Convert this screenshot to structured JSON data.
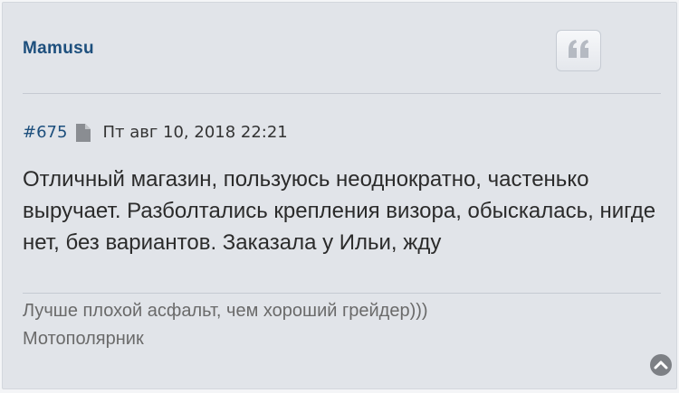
{
  "post": {
    "author": "Mamusu",
    "number": "#675",
    "date": "Пт авг 10, 2018 22:21",
    "text": "Отличный магазин, пользуюсь неоднократно, частенько выручает. Разболтались крепления визора, обыскалась, нигде нет, без вариантов. Заказала у Ильи, жду"
  },
  "signature": {
    "line1": "Лучше плохой асфальт, чем хороший грейдер)))",
    "line2": "Мотополярник"
  },
  "icons": {
    "quote": "quote-icon",
    "file": "file-icon",
    "scroll_top": "chevron-up-circle-icon"
  },
  "colors": {
    "author": "#1d4f7d",
    "background": "#e1e4e9"
  }
}
